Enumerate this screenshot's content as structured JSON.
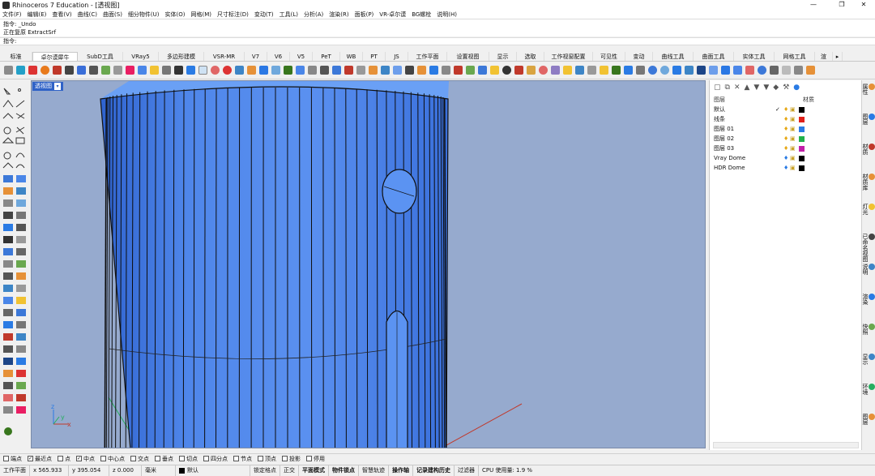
{
  "window": {
    "title": "Rhinoceros 7 Education - [透视图]",
    "controls": [
      "—",
      "❐",
      "✕"
    ]
  },
  "menu": [
    "文件(F)",
    "编辑(E)",
    "查看(V)",
    "曲线(C)",
    "曲面(S)",
    "细分物件(U)",
    "实体(O)",
    "网格(M)",
    "尺寸标注(D)",
    "变动(T)",
    "工具(L)",
    "分析(A)",
    "渲染(R)",
    "面板(P)",
    "VR-卓尔谟",
    "BG螺栓",
    "说明(H)"
  ],
  "command_history": [
    "指令: _Undo",
    "正在复原 ExtractSrf"
  ],
  "command_prompt": "指令:",
  "tabs": [
    "标准",
    "卓尔谟犀牛",
    "SubD工具",
    "VRay5",
    "多边形建模",
    "VSR-MR",
    "V7",
    "V6",
    "V5",
    "PeT",
    "WB",
    "PT",
    "JS",
    "工作平面",
    "设置视图",
    "显示",
    "选取",
    "工作视窗配置",
    "可见性",
    "变动",
    "曲线工具",
    "曲面工具",
    "实体工具",
    "网格工具",
    "渲"
  ],
  "active_tab": "卓尔谟犀牛",
  "viewport": {
    "label": "透视图",
    "axes": {
      "x": "x",
      "y": "y",
      "z": "z"
    },
    "colors": {
      "background": "#96aace",
      "cylinder": "#4f86ea",
      "cylinder_top": "#6aa0f5",
      "grid_x": "#c0392b",
      "grid_y": "#27ae60"
    }
  },
  "layers_panel": {
    "header_name": "图层",
    "header_material": "材质",
    "layers": [
      {
        "name": "默认",
        "current": "✓",
        "color": "#000000"
      },
      {
        "name": "线条",
        "current": "",
        "color": "#e0201a"
      },
      {
        "name": "图层 01",
        "current": "",
        "color": "#2a7be4"
      },
      {
        "name": "图层 02",
        "current": "",
        "color": "#21b14b"
      },
      {
        "name": "图层 03",
        "current": "",
        "color": "#c21fa8"
      },
      {
        "name": "Vray Dome",
        "current": "",
        "color": "#000000"
      },
      {
        "name": "HDR Dome",
        "current": "",
        "color": "#000000"
      }
    ]
  },
  "side_tabs": [
    "属性",
    "图层",
    "材质",
    "材质库",
    "灯光",
    "已命名视图",
    "说明",
    "渲染",
    "快照",
    "显示",
    "环境",
    "图层"
  ],
  "osnaps": [
    {
      "label": "端点",
      "checked": false
    },
    {
      "label": "最近点",
      "checked": true
    },
    {
      "label": "点",
      "checked": false
    },
    {
      "label": "中点",
      "checked": true
    },
    {
      "label": "中心点",
      "checked": false
    },
    {
      "label": "交点",
      "checked": false
    },
    {
      "label": "垂点",
      "checked": false
    },
    {
      "label": "切点",
      "checked": false
    },
    {
      "label": "四分点",
      "checked": false
    },
    {
      "label": "节点",
      "checked": false
    },
    {
      "label": "顶点",
      "checked": false
    },
    {
      "label": "投影",
      "checked": false
    },
    {
      "label": "停用",
      "checked": false
    }
  ],
  "status": {
    "cplane": "工作平面",
    "x": "x 565.933",
    "y": "y 395.054",
    "z": "z 0.000",
    "unit": "毫米",
    "layer": "默认",
    "toggles": [
      "锁定格点",
      "正交",
      "平面模式",
      "物件锁点",
      "智慧轨迹",
      "操作轴",
      "记录建构历史",
      "过滤器"
    ],
    "cpu": "CPU 使用量: 1.9 %"
  }
}
